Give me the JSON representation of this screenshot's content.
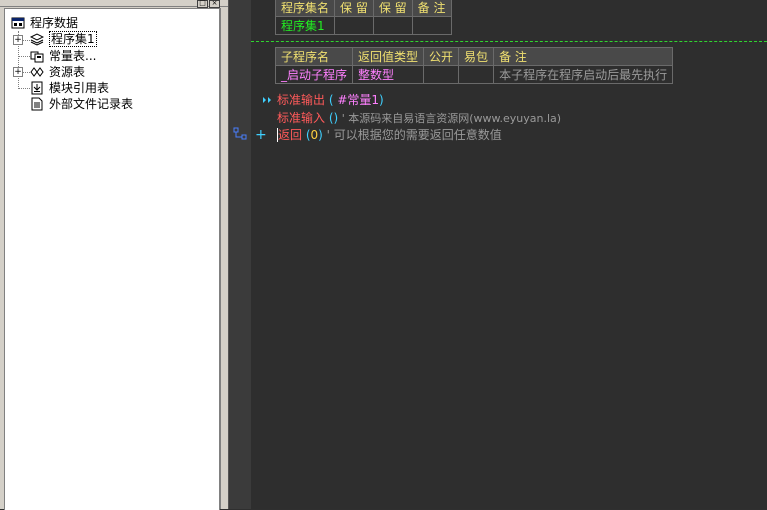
{
  "tree": {
    "root": "程序数据",
    "items": [
      {
        "label": "程序集1",
        "expandable": true,
        "icon": "stack-icon"
      },
      {
        "label": "常量表...",
        "expandable": false,
        "icon": "constant-icon"
      },
      {
        "label": "资源表",
        "expandable": true,
        "icon": "resource-icon"
      },
      {
        "label": "模块引用表",
        "expandable": false,
        "icon": "module-icon"
      },
      {
        "label": "外部文件记录表",
        "expandable": false,
        "icon": "file-icon"
      }
    ]
  },
  "assembly_table": {
    "headers": [
      "程序集名",
      "保 留",
      "保 留",
      "备 注"
    ],
    "row": [
      "程序集1",
      "",
      "",
      ""
    ]
  },
  "sub_table": {
    "headers": [
      "子程序名",
      "返回值类型",
      "公开",
      "易包",
      "备 注"
    ],
    "row": [
      "_启动子程序",
      "整数型",
      "",
      "",
      "本子程序在程序启动后最先执行"
    ]
  },
  "code": [
    {
      "cmd": "标准输出",
      "open": " (",
      "arg": " #常量1",
      "close": ")",
      "comment": ""
    },
    {
      "cmd": "标准输入",
      "open": " ()",
      "arg": "",
      "close": "",
      "comment": " ' 本源码来自易语言资源网(www.eyuyan.la)"
    },
    {
      "cmd": "返回",
      "open": " (",
      "arg": "0",
      "close": ")",
      "comment": " ' 可以根据您的需要返回任意数值"
    }
  ],
  "colors": {
    "keyword": "#ff5a5a",
    "paren": "#3fd0ff",
    "constant": "#ff80ff",
    "number": "#ffd040",
    "comment": "#9a9a9a",
    "header_text": "#f0e070",
    "assembly_name": "#22ee22",
    "sub_name": "#ff80ff",
    "separator": "#2fd62f"
  }
}
